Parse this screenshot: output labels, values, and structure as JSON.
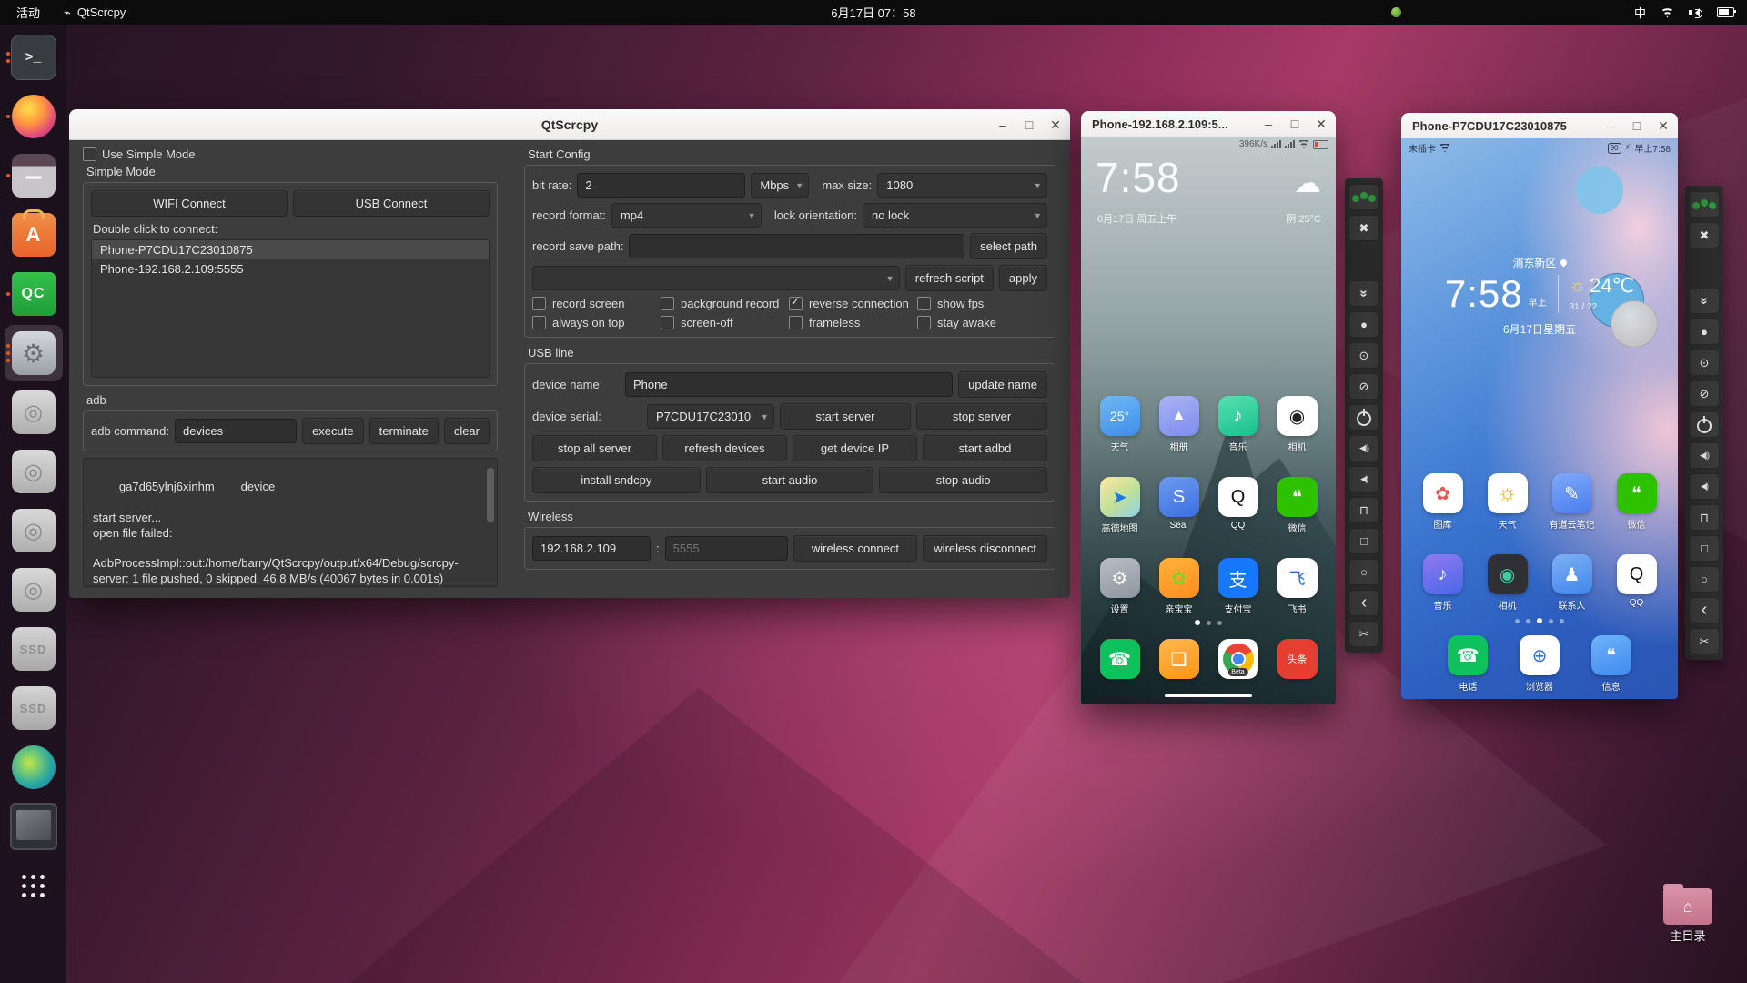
{
  "colors": {
    "accent_orange": "#E95420",
    "titlebar_bg": "#F6F5F4",
    "window_bg": "#3D3D3D",
    "button_bg": "#343434",
    "group_green": "#2E9A3C",
    "wechat_green": "#2DC100",
    "alipay_blue": "#1678FF",
    "phone_green": "#0EC15C"
  },
  "window_controls": {
    "minimize": "–",
    "maximize": "□",
    "close": "✕"
  },
  "topbar": {
    "activities": "活动",
    "app_icon": "⌁",
    "app_name": "QtScrcpy",
    "clock": "6月17日 07：58",
    "input_method": "中"
  },
  "dock": {
    "items": [
      {
        "name": "terminal",
        "glyph": ">_",
        "cls": "ic-terminal",
        "dots": "dots-2",
        "active": ""
      },
      {
        "name": "firefox",
        "glyph": "",
        "cls": "ic-firefox",
        "dots": "dots-1",
        "active": ""
      },
      {
        "name": "files",
        "glyph": "",
        "cls": "ic-files",
        "dots": "dots-1",
        "active": ""
      },
      {
        "name": "ubuntu-software",
        "glyph": "A",
        "cls": "ic-software",
        "dots": "dots-0",
        "active": ""
      },
      {
        "name": "qtcreator",
        "glyph": "QC",
        "cls": "ic-qc",
        "dots": "dots-1",
        "active": ""
      },
      {
        "name": "settings",
        "glyph": "⚙",
        "cls": "ic-settings",
        "dots": "dots-3",
        "active": "active"
      },
      {
        "name": "disk-drive-1",
        "glyph": "◎",
        "cls": "ic-disk",
        "dots": "dots-0",
        "active": ""
      },
      {
        "name": "disk-drive-2",
        "glyph": "◎",
        "cls": "ic-disk",
        "dots": "dots-0",
        "active": ""
      },
      {
        "name": "disk-drive-3",
        "glyph": "◎",
        "cls": "ic-disk",
        "dots": "dots-0",
        "active": ""
      },
      {
        "name": "disk-drive-4",
        "glyph": "◎",
        "cls": "ic-disk",
        "dots": "dots-0",
        "active": ""
      },
      {
        "name": "ssd-drive-1",
        "glyph": "SSD",
        "cls": "ic-ssd",
        "dots": "dots-0",
        "active": ""
      },
      {
        "name": "ssd-drive-2",
        "glyph": "SSD",
        "cls": "ic-ssd",
        "dots": "dots-0",
        "active": ""
      },
      {
        "name": "gparted",
        "glyph": "",
        "cls": "ic-gparted",
        "dots": "dots-0",
        "active": ""
      },
      {
        "name": "tablet-device",
        "glyph": "",
        "cls": "ic-tablet",
        "dots": "dots-0",
        "active": ""
      },
      {
        "name": "show-applications",
        "glyph": "",
        "cls": "ic-apps",
        "dots": "dots-0",
        "active": ""
      }
    ]
  },
  "main_window": {
    "title": "QtScrcpy",
    "simple": {
      "use_simple_mode": "Use Simple Mode",
      "section_label": "Simple Mode",
      "wifi_connect": "WIFI Connect",
      "usb_connect": "USB Connect",
      "double_click": "Double click to connect:",
      "devices": [
        {
          "label": "Phone-P7CDU17C23010875",
          "cls": "selected"
        },
        {
          "label": "Phone-192.168.2.109:5555",
          "cls": ""
        }
      ]
    },
    "adb": {
      "section_label": "adb",
      "command_label": "adb command:",
      "command_value": "devices",
      "execute": "execute",
      "terminate": "terminate",
      "clear": "clear",
      "log": "ga7d65ylnj6xinhm        device\n\nstart server...\nopen file failed:\n\nAdbProcessImpl::out:/home/barry/QtScrcpy/output/x64/Debug/scrcpy-server: 1 file pushed, 0 skipped. 46.8 MB/s (40067 bytes in 0.001s)"
    },
    "start_config": {
      "section_label": "Start Config",
      "bit_rate_label": "bit rate:",
      "bit_rate_value": "2",
      "bit_rate_unit": "Mbps",
      "max_size_label": "max size:",
      "max_size_value": "1080",
      "record_format_label": "record format:",
      "record_format_value": "mp4",
      "lock_orientation_label": "lock orientation:",
      "lock_orientation_value": "no lock",
      "record_save_path_label": "record save path:",
      "record_save_path_value": "",
      "select_path": "select path",
      "script_value": "",
      "refresh_script": "refresh script",
      "apply": "apply",
      "checks_row1": [
        {
          "label": "record screen",
          "state": ""
        },
        {
          "label": "background record",
          "state": ""
        },
        {
          "label": "reverse connection",
          "state": "checked"
        },
        {
          "label": "show fps",
          "state": ""
        }
      ],
      "checks_row2": [
        {
          "label": "always on top",
          "state": ""
        },
        {
          "label": "screen-off",
          "state": ""
        },
        {
          "label": "frameless",
          "state": ""
        },
        {
          "label": "stay awake",
          "state": ""
        }
      ]
    },
    "usb_line": {
      "section_label": "USB line",
      "device_name_label": "device name:",
      "device_name_value": "Phone",
      "update_name": "update name",
      "device_serial_label": "device serial:",
      "device_serial_value": "P7CDU17C23010",
      "start_server": "start server",
      "stop_server": "stop server",
      "row3": [
        {
          "label": "stop all server"
        },
        {
          "label": "refresh devices"
        },
        {
          "label": "get device IP"
        },
        {
          "label": "start adbd"
        }
      ],
      "row4": [
        {
          "label": "install sndcpy"
        },
        {
          "label": "start audio"
        },
        {
          "label": "stop audio"
        }
      ]
    },
    "wireless": {
      "section_label": "Wireless",
      "ip_value": "192.168.2.109",
      "separator": ":",
      "port_placeholder": "5555",
      "connect": "wireless connect",
      "disconnect": "wireless disconnect"
    }
  },
  "phone_toolbar": {
    "buttons": [
      {
        "name": "group-control-button",
        "glyph": "",
        "cls": "tb-group"
      },
      {
        "name": "fullscreen-button",
        "glyph": "✖",
        "cls": ""
      },
      {
        "name": "expand-collapse-button",
        "glyph": "»",
        "cls": "tb-rot90 tb-gap"
      },
      {
        "name": "touch-toggle-button",
        "glyph": "●",
        "cls": ""
      },
      {
        "name": "screen-on-button",
        "glyph": "⊙",
        "cls": ""
      },
      {
        "name": "screen-off-button",
        "glyph": "⊘",
        "cls": ""
      },
      {
        "name": "power-button",
        "glyph": "",
        "cls": "tb-power"
      },
      {
        "name": "volume-up-button",
        "glyph": "◀))",
        "cls": "tb-small"
      },
      {
        "name": "volume-down-button",
        "glyph": "◀)",
        "cls": "tb-small"
      },
      {
        "name": "app-switch-button",
        "glyph": "⊓",
        "cls": ""
      },
      {
        "name": "menu-button",
        "glyph": "□",
        "cls": ""
      },
      {
        "name": "home-button",
        "glyph": "○",
        "cls": ""
      },
      {
        "name": "back-button",
        "glyph": "‹",
        "cls": "tb-big"
      },
      {
        "name": "screenshot-button",
        "glyph": "✂",
        "cls": ""
      }
    ]
  },
  "phone1": {
    "title": "Phone-192.168.2.109:5...",
    "status_net": "396K/s",
    "clock": "7:58",
    "cloud": "☁",
    "date": "6月17日 周五上午",
    "weather": "阴  25°C",
    "apps": [
      {
        "label": "天气",
        "glyph": "25°",
        "bg": "linear-gradient(160deg,#6fb9f5,#3f8de8)",
        "color": "#fff",
        "fs": "14px"
      },
      {
        "label": "相册",
        "glyph": "▲",
        "bg": "linear-gradient(160deg,#a9b4f4,#7e8bee)",
        "color": "#fff",
        "fs": "16px"
      },
      {
        "label": "音乐",
        "glyph": "♪",
        "bg": "linear-gradient(160deg,#57e0b1,#17c08c)",
        "color": "#fff"
      },
      {
        "label": "相机",
        "glyph": "◉",
        "bg": "#ffffff",
        "color": "#222"
      },
      {
        "label": "高德地图",
        "glyph": "➤",
        "bg": "linear-gradient(140deg,#ffe6a3,#bfe098 55%,#8fd0f0)",
        "color": "#1a78e8"
      },
      {
        "label": "Seal",
        "glyph": "S",
        "bg": "linear-gradient(160deg,#6d9bef,#3c6fe0)",
        "color": "#fff"
      },
      {
        "label": "QQ",
        "glyph": "Q",
        "bg": "#ffffff",
        "color": "#111"
      },
      {
        "label": "微信",
        "glyph": "❝",
        "bg": "#2DC100",
        "color": "#fff"
      },
      {
        "label": "设置",
        "glyph": "⚙",
        "bg": "linear-gradient(160deg,#b9bec6,#8e959f)",
        "color": "#fff"
      },
      {
        "label": "亲宝宝",
        "glyph": "✿",
        "bg": "linear-gradient(160deg,#ffb23e,#ff8d1a)",
        "color": "#7ed321"
      },
      {
        "label": "支付宝",
        "glyph": "支",
        "bg": "#1678FF",
        "color": "#fff"
      },
      {
        "label": "飞书",
        "glyph": "飞",
        "bg": "#ffffff",
        "color": "#2a6fe8",
        "fs": "18px"
      }
    ],
    "dock_apps": [
      {
        "label": "",
        "glyph": "☎",
        "bg": "#0EC15C",
        "color": "#fff"
      },
      {
        "label": "",
        "glyph": "❏",
        "bg": "linear-gradient(160deg,#ffb84d,#ff9416)",
        "color": "#fff"
      },
      {
        "label": "",
        "glyph": "",
        "bg": "#ffffff",
        "color": "#fff",
        "cls": "chrome",
        "badge": "Beta"
      },
      {
        "label": "",
        "glyph": "头条",
        "bg": "#e63e31",
        "color": "#fff",
        "fs": "11px"
      }
    ],
    "dots": [
      {
        "cls": "on"
      },
      {
        "cls": ""
      },
      {
        "cls": ""
      }
    ]
  },
  "phone2": {
    "title": "Phone-P7CDU17C23010875",
    "status_left": "未插卡",
    "battery_pct": "90",
    "charge": "⚡",
    "status_time": "早上7:58",
    "city": "浦东新区",
    "clock": "7:58",
    "ampm": "早上",
    "sun": "☼",
    "temp": "24℃",
    "hilo": "31 / 22",
    "date": "6月17日星期五",
    "apps": [
      {
        "label": "图库",
        "glyph": "✿",
        "bg": "#ffffff",
        "color": "#e8574f"
      },
      {
        "label": "天气",
        "glyph": "☼",
        "bg": "#ffffff",
        "color": "#f5a623",
        "fs": "24px"
      },
      {
        "label": "有道云笔记",
        "glyph": "✎",
        "bg": "linear-gradient(160deg,#7fa8f8,#4a7ef0)",
        "color": "#fff"
      },
      {
        "label": "微信",
        "glyph": "❝",
        "bg": "#2DC100",
        "color": "#fff"
      },
      {
        "label": "音乐",
        "glyph": "♪",
        "bg": "linear-gradient(160deg,#8f7bf0,#4a66e8)",
        "color": "#fff"
      },
      {
        "label": "相机",
        "glyph": "◉",
        "bg": "#2e3033",
        "color": "#3ad0a4"
      },
      {
        "label": "联系人",
        "glyph": "♟",
        "bg": "linear-gradient(160deg,#7fb0f5,#3f86ec)",
        "color": "#fff"
      },
      {
        "label": "QQ",
        "glyph": "Q",
        "bg": "#ffffff",
        "color": "#111"
      }
    ],
    "dock_apps": [
      {
        "label": "电话",
        "glyph": "☎",
        "bg": "#0ec15c",
        "color": "#fff"
      },
      {
        "label": "浏览器",
        "glyph": "⊕",
        "bg": "#ffffff",
        "color": "#2f6fe4"
      },
      {
        "label": "信息",
        "glyph": "❝",
        "bg": "linear-gradient(160deg,#6fb3f8,#3f8af0)",
        "color": "#fff"
      }
    ],
    "dots": [
      {
        "cls": ""
      },
      {
        "cls": ""
      },
      {
        "cls": "on"
      },
      {
        "cls": ""
      },
      {
        "cls": ""
      }
    ]
  },
  "desktop": {
    "home_label": "主目录"
  }
}
